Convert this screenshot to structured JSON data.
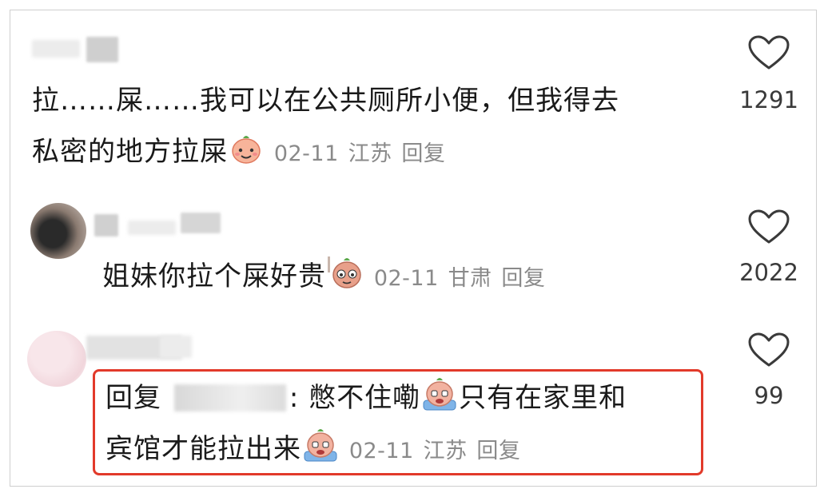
{
  "comments": [
    {
      "line1": "拉……屎……我可以在公共厕所小便，但我得去",
      "line2": "私密的地方拉屎",
      "date": "02-11",
      "location": "江苏",
      "reply": "回复",
      "likes": "1291"
    },
    {
      "line1": "姐妹你拉个屎好贵",
      "date": "02-11",
      "location": "甘肃",
      "reply": "回复",
      "likes": "2022"
    },
    {
      "reply_prefix": "回复",
      "line1_text": ": 憋不住嘞",
      "line1_tail": "只有在家里和",
      "line2": "宾馆才能拉出来",
      "date": "02-11",
      "location": "江苏",
      "reply": "回复",
      "likes": "99"
    }
  ],
  "icons": [
    "heart-icon",
    "emoji-smile",
    "emoji-shy",
    "emoji-cry"
  ],
  "colors": {
    "highlight": "#e23a2a",
    "meta": "#8a8a8a",
    "text": "#1a1a1a"
  }
}
